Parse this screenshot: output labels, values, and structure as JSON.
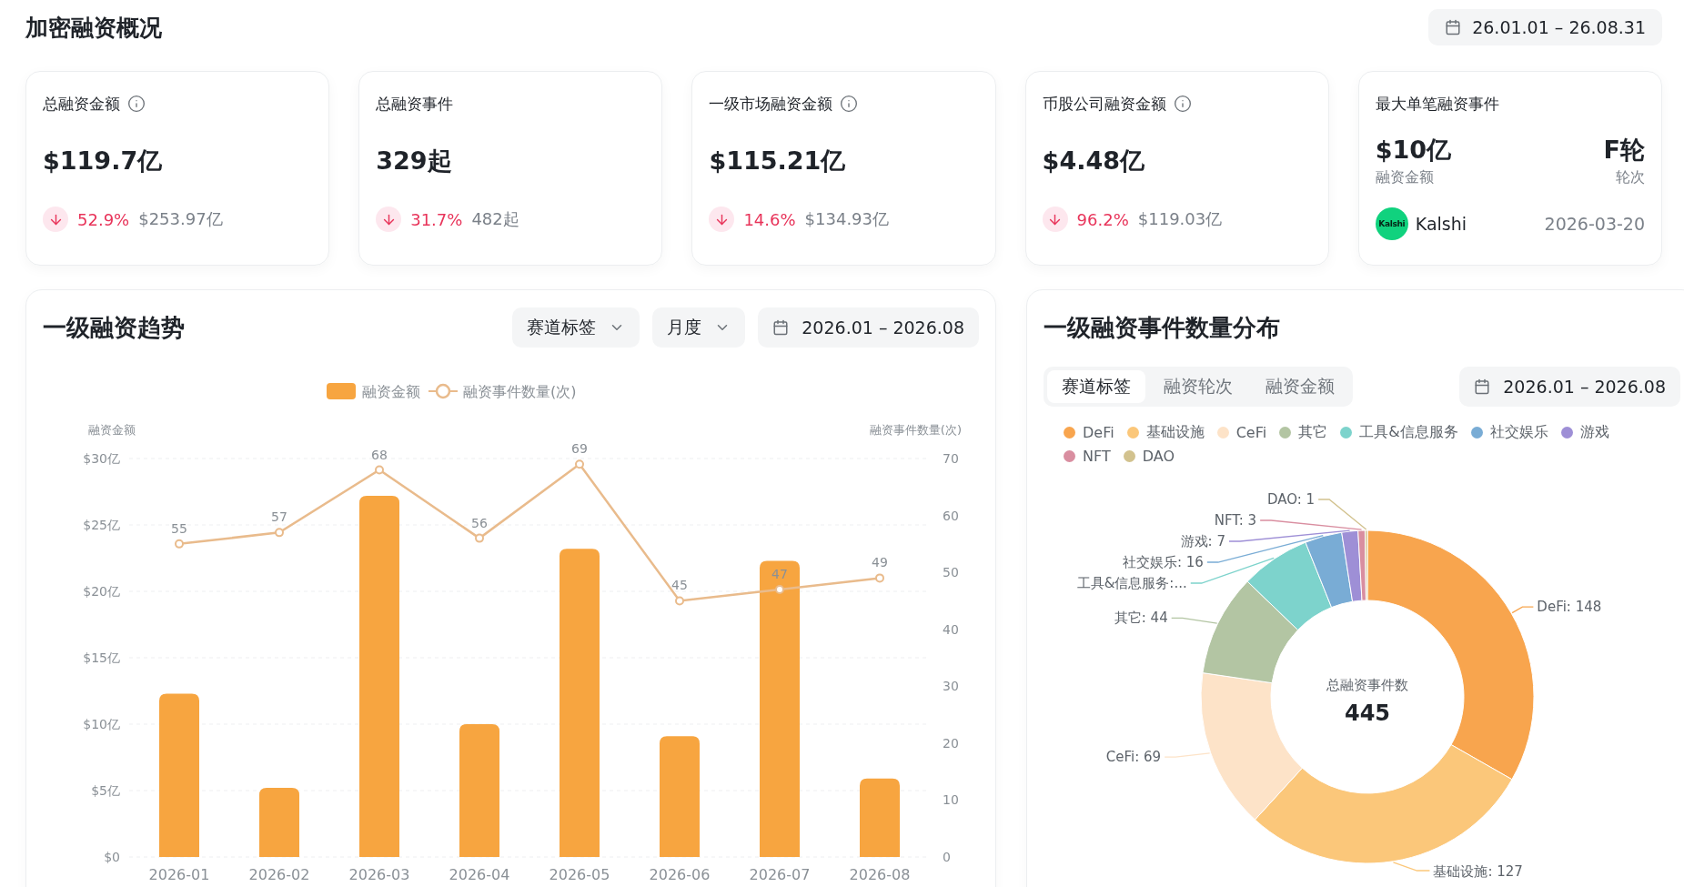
{
  "header": {
    "title": "加密融资概况",
    "date_range": "26.01.01 – 26.08.31"
  },
  "stat_cards": [
    {
      "kind": "stat",
      "title": "总融资金额",
      "info": true,
      "falling": true,
      "value": "$119.7亿",
      "change": "52.9%",
      "previous": "$253.97亿"
    },
    {
      "kind": "stat",
      "title": "总融资事件",
      "info": false,
      "falling": true,
      "value": "329起",
      "change": "31.7%",
      "previous": "482起"
    },
    {
      "kind": "stat",
      "title": "一级市场融资金额",
      "info": true,
      "falling": true,
      "value": "$115.21亿",
      "change": "14.6%",
      "previous": "$134.93亿"
    },
    {
      "kind": "stat",
      "title": "币股公司融资金额",
      "info": true,
      "falling": true,
      "value": "$4.48亿",
      "change": "96.2%",
      "previous": "$119.03亿"
    },
    {
      "kind": "event",
      "title": "最大单笔融资事件",
      "amount": "$10亿",
      "amount_label": "融资金额",
      "round": "F轮",
      "round_label": "轮次",
      "logo_text": "Kalshi",
      "company": "Kalshi",
      "date": "2026-03-20"
    }
  ],
  "trend": {
    "title": "一级融资趋势",
    "filters": [
      {
        "label": "赛道标签"
      },
      {
        "label": "月度"
      }
    ],
    "date_range": "2026.01 – 2026.08",
    "chart_data": {
      "type": "bar",
      "ylabel": "融资金额",
      "y2label": "融资事件数量(次)",
      "grid": true,
      "legend": true,
      "categories": [
        "2026-01",
        "2026-02",
        "2026-03",
        "2026-04",
        "2026-05",
        "2026-06",
        "2026-07",
        "2026-08"
      ],
      "series": [
        {
          "name": "融资金额",
          "color": "#f7a540",
          "type": "bar",
          "values": [
            12.3,
            5.2,
            27.2,
            10.0,
            23.2,
            9.1,
            22.3,
            5.9
          ]
        },
        {
          "name": "融资事件数量(次)",
          "color": "#e9bb8c",
          "type": "line",
          "axis": "y2",
          "marker": true,
          "values": [
            55,
            57,
            68,
            56,
            69,
            45,
            47,
            49
          ]
        }
      ],
      "ylim": [
        0,
        30
      ],
      "yticks": [
        {
          "value": 0,
          "label": "$0"
        },
        {
          "value": 5,
          "label": "$5亿"
        },
        {
          "value": 10,
          "label": "$10亿"
        },
        {
          "value": 15,
          "label": "$15亿"
        },
        {
          "value": 20,
          "label": "$20亿"
        },
        {
          "value": 25,
          "label": "$25亿"
        },
        {
          "value": 30,
          "label": "$30亿"
        }
      ],
      "y2lim": [
        0,
        70
      ],
      "y2ticks": [
        0,
        10,
        20,
        30,
        40,
        50,
        60,
        70
      ],
      "value_labels": [
        "55",
        "57",
        "68",
        "56",
        "69",
        "45",
        "47",
        "49"
      ]
    }
  },
  "distribution": {
    "title": "一级融资事件数量分布",
    "tabs": [
      {
        "label": "赛道标签",
        "selected": true
      },
      {
        "label": "融资轮次",
        "selected": false
      },
      {
        "label": "融资金额",
        "selected": false
      }
    ],
    "date_range": "2026.01 – 2026.08",
    "chart_data": {
      "type": "donut",
      "categories": [
        "DeFi",
        "基础设施",
        "CeFi",
        "其它",
        "工具&信息服务",
        "社交娱乐",
        "游戏",
        "NFT",
        "DAO"
      ],
      "values": [
        148,
        127,
        69,
        44,
        30,
        16,
        7,
        3,
        1
      ],
      "colors": [
        "#f8a54e",
        "#fbc77a",
        "#fde3c8",
        "#b3c5a3",
        "#7dd3cc",
        "#79acd5",
        "#9e8fd6",
        "#d98ea0",
        "#d2c28e"
      ],
      "value_labels": [
        "DeFi: 148",
        "基础设施: 127",
        "CeFi: 69",
        "其它: 44",
        "工具&信息服务:...",
        "社交娱乐: 16",
        "游戏: 7",
        "NFT: 3",
        "DAO: 1"
      ],
      "annotations": [
        {
          "text": "总融资事件数"
        },
        {
          "text": "445"
        }
      ]
    }
  }
}
